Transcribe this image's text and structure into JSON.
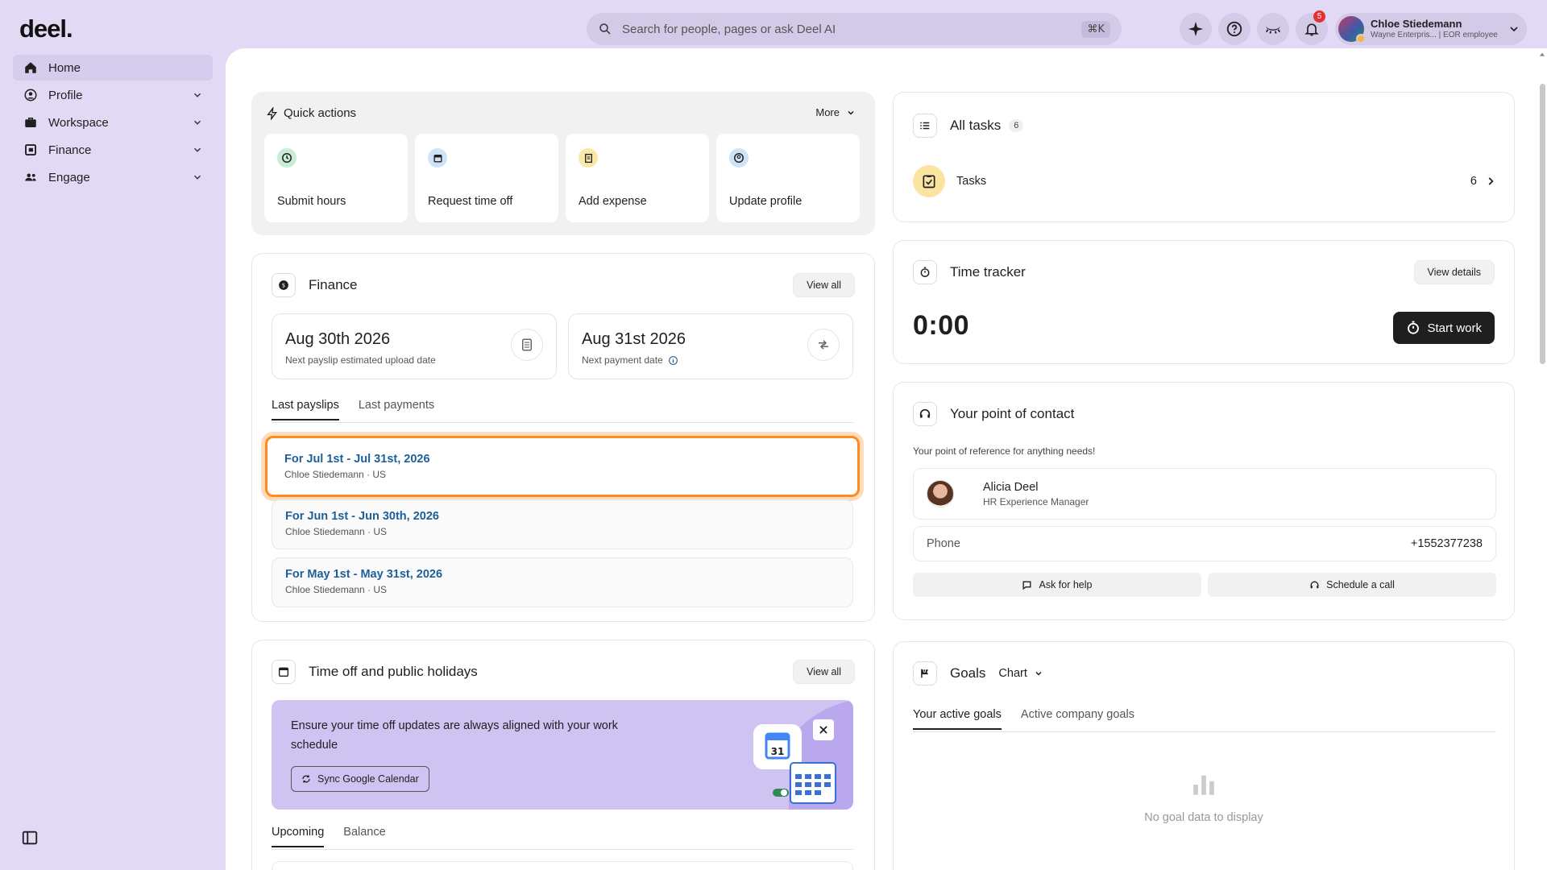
{
  "brand": {
    "logo": "deel."
  },
  "sidebar": {
    "items": [
      {
        "label": "Home",
        "icon": "home-icon",
        "active": true
      },
      {
        "label": "Profile",
        "icon": "user-circle-icon"
      },
      {
        "label": "Workspace",
        "icon": "briefcase-icon"
      },
      {
        "label": "Finance",
        "icon": "finance-icon"
      },
      {
        "label": "Engage",
        "icon": "people-icon"
      }
    ]
  },
  "search": {
    "placeholder": "Search for people, pages or ask Deel AI",
    "shortcut": "⌘K"
  },
  "topbar": {
    "notifications_count": "5"
  },
  "user": {
    "name": "Chloe Stiedemann",
    "subtitle": "Wayne Enterpris... | EOR employee"
  },
  "quick_actions": {
    "title": "Quick actions",
    "more": "More",
    "tiles": [
      {
        "label": "Submit hours",
        "icon": "clock-icon",
        "color": "#c9ecd4"
      },
      {
        "label": "Request time off",
        "icon": "calendar-icon",
        "color": "#cfe3f7"
      },
      {
        "label": "Add expense",
        "icon": "receipt-icon",
        "color": "#f9e9a6"
      },
      {
        "label": "Update profile",
        "icon": "user-icon",
        "color": "#cfe3f7"
      }
    ]
  },
  "finance": {
    "title": "Finance",
    "view_all": "View all",
    "payslip_date": "Aug 30th 2026",
    "payslip_date_label": "Next payslip estimated upload date",
    "payment_date": "Aug 31st 2026",
    "payment_date_label": "Next payment date",
    "tabs": [
      "Last payslips",
      "Last payments"
    ],
    "payslips": [
      {
        "title": "For Jul 1st - Jul 31st, 2026",
        "sub": "Chloe Stiedemann · US"
      },
      {
        "title": "For Jun 1st - Jun 30th, 2026",
        "sub": "Chloe Stiedemann · US"
      },
      {
        "title": "For May 1st - May 31st, 2026",
        "sub": "Chloe Stiedemann · US"
      }
    ]
  },
  "time_off": {
    "title": "Time off and public holidays",
    "view_all": "View all",
    "banner_text": "Ensure your time off updates are always aligned with your work schedule",
    "sync_button": "Sync Google Calendar",
    "calendar_day": "31",
    "tabs": [
      "Upcoming",
      "Balance"
    ]
  },
  "tasks": {
    "title": "All tasks",
    "count": "6",
    "row_label": "Tasks",
    "row_count": "6"
  },
  "time_tracker": {
    "title": "Time tracker",
    "view_details": "View details",
    "timer": "0:00",
    "start_button": "Start work"
  },
  "point_of_contact": {
    "title": "Your point of contact",
    "subtitle": "Your point of reference for anything needs!",
    "name": "Alicia Deel",
    "role": "HR Experience Manager",
    "phone_label": "Phone",
    "phone_value": "+1552377238",
    "ask_help": "Ask for help",
    "schedule_call": "Schedule a call"
  },
  "goals": {
    "title": "Goals",
    "view_select": "Chart",
    "tabs": [
      "Your active goals",
      "Active company goals"
    ],
    "empty_text": "No goal data to display"
  },
  "colors": {
    "accent": "#ff8a1e",
    "link": "#1d5f9a",
    "bg": "#e2d9f5",
    "banner": "#cfc4f1"
  }
}
